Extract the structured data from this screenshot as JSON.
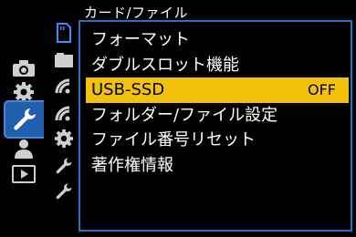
{
  "header": {
    "title": "カード/ファイル"
  },
  "menu": {
    "items": [
      {
        "label": "フォーマット",
        "value": ""
      },
      {
        "label": "ダブルスロット機能",
        "value": ""
      },
      {
        "label": "USB-SSD",
        "value": "OFF"
      },
      {
        "label": "フォルダー/ファイル設定",
        "value": ""
      },
      {
        "label": "ファイル番号リセット",
        "value": ""
      },
      {
        "label": "著作権情報",
        "value": ""
      }
    ],
    "selected_index": 2
  },
  "categories": [
    {
      "icon": "camera-icon"
    },
    {
      "icon": "gear-icon"
    },
    {
      "icon": "wrench-icon",
      "active": true
    },
    {
      "icon": "person-icon"
    },
    {
      "icon": "playback-icon"
    }
  ],
  "subpages": [
    {
      "icon": "sd-card-icon",
      "active": true
    },
    {
      "icon": "folder-icon"
    },
    {
      "icon": "signal-bars-icon"
    },
    {
      "icon": "signal-bars-icon"
    },
    {
      "icon": "gear-icon"
    },
    {
      "icon": "wrench-icon"
    },
    {
      "icon": "wrench-icon"
    }
  ],
  "colors": {
    "accent_blue": "#1f5fae",
    "frame_blue": "#2f6dbd",
    "highlight_yellow": "#f2c20a",
    "background": "#000000",
    "text": "#ffffff"
  }
}
